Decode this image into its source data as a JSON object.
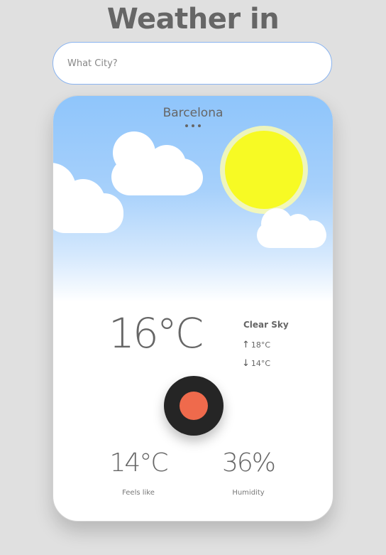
{
  "header": {
    "title": "Weather in"
  },
  "search": {
    "placeholder": "What City?",
    "value": ""
  },
  "card": {
    "city": "Barcelona",
    "temperature": "16°C",
    "condition": "Clear Sky",
    "high": "18°C",
    "low": "14°C",
    "feels_like": {
      "value": "14°C",
      "label": "Feels like"
    },
    "humidity": {
      "value": "36%",
      "label": "Humidity"
    }
  },
  "icons": {
    "weather": "sun-icon",
    "clouds": "cloud-icon",
    "high": "arrow-up-icon",
    "low": "arrow-down-icon",
    "menu": "more-dots-icon",
    "action": "record-icon"
  },
  "colors": {
    "sky_top": "#8fc5fb",
    "sun": "#f7fa24",
    "sun_glow": "#fbfbb0",
    "record_button": "#252525",
    "record_dot": "#ef6a4c",
    "text": "#666666",
    "search_border": "#8ab4f0"
  }
}
